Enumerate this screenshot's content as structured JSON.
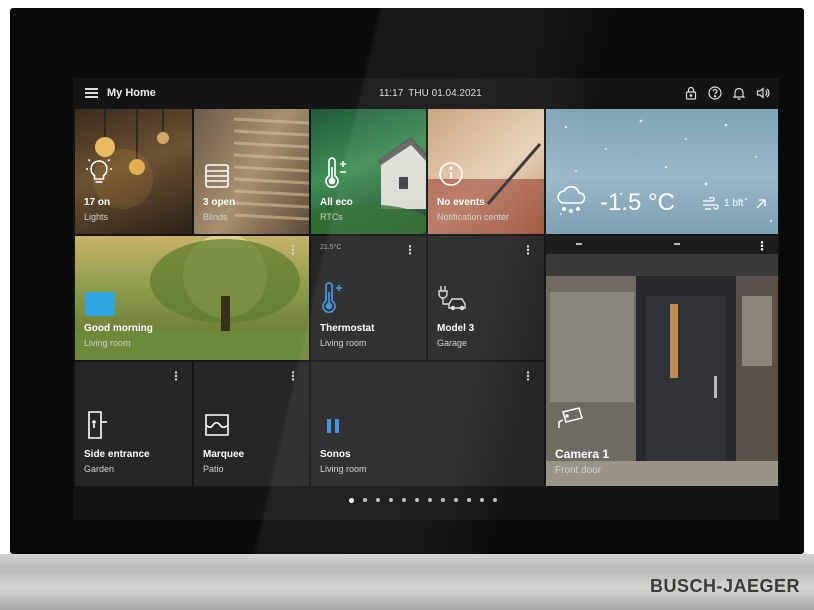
{
  "header": {
    "title": "My Home",
    "time": "11:17",
    "date": "THU 01.04.2021",
    "icons": [
      "lock-icon",
      "help-icon",
      "bell-icon",
      "speaker-icon"
    ]
  },
  "tiles": {
    "lights": {
      "value": "17 on",
      "label": "Lights",
      "icon": "lightbulb-icon"
    },
    "blinds": {
      "value": "3 open",
      "label": "Blinds",
      "icon": "blinds-icon"
    },
    "rtcs": {
      "value": "All eco",
      "label": "RTCs",
      "icon": "thermometer-icon"
    },
    "notifications": {
      "value": "No events",
      "label": "Notification center",
      "icon": "info-icon"
    },
    "weather": {
      "temperature": "-1.5 °C",
      "wind": "1 bft",
      "icon": "snow-cloud-icon"
    },
    "scene": {
      "title": "Good morning",
      "room": "Living room"
    },
    "thermostat": {
      "title": "Thermostat",
      "room": "Living room",
      "reading": "21.5°C"
    },
    "garage": {
      "title": "Model 3",
      "room": "Garage",
      "icon": "ev-charger-icon"
    },
    "camera": {
      "title": "Camera 1",
      "room": "Front door",
      "icon": "camera-icon"
    },
    "side_entrance": {
      "title": "Side entrance",
      "room": "Garden",
      "icon": "door-icon"
    },
    "marquee": {
      "title": "Marquee",
      "room": "Patio",
      "icon": "awning-icon"
    },
    "sonos": {
      "title": "Sonos",
      "room": "Living room",
      "icon": "pause-icon"
    }
  },
  "pager": {
    "pages": 12,
    "active": 1
  },
  "device": {
    "brand": "BUSCH-JAEGER"
  },
  "colors": {
    "accent_blue": "#3c8fe0",
    "background": "#141414",
    "tile": "#262626"
  }
}
